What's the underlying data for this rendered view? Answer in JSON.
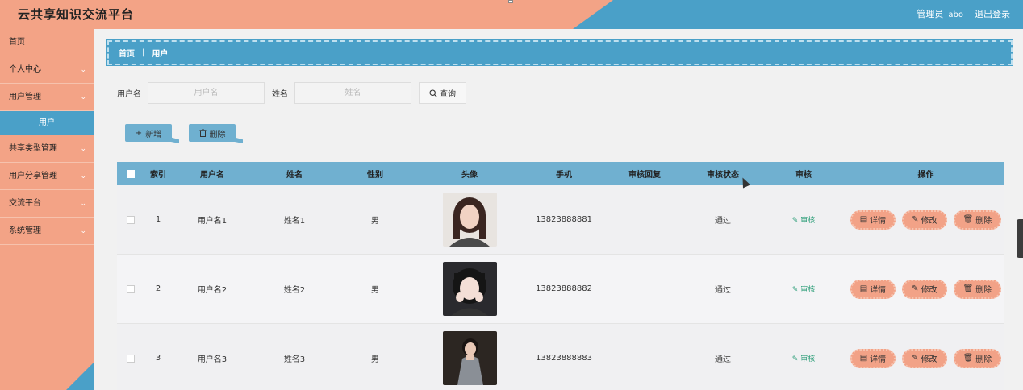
{
  "header": {
    "title": "云共享知识交流平台",
    "role": "管理员",
    "username": "abo",
    "logout": "退出登录"
  },
  "sidebar": {
    "items": [
      {
        "label": "首页",
        "has_sub": false
      },
      {
        "label": "个人中心",
        "has_sub": true
      },
      {
        "label": "用户管理",
        "has_sub": true
      },
      {
        "label": "用户",
        "is_sub": true,
        "active": true
      },
      {
        "label": "共享类型管理",
        "has_sub": true
      },
      {
        "label": "用户分享管理",
        "has_sub": true
      },
      {
        "label": "交流平台",
        "has_sub": true
      },
      {
        "label": "系统管理",
        "has_sub": true
      }
    ]
  },
  "breadcrumb": {
    "home": "首页",
    "current": "用户"
  },
  "search": {
    "username_label": "用户名",
    "username_placeholder": "用户名",
    "name_label": "姓名",
    "name_placeholder": "姓名",
    "query_label": "查询"
  },
  "actions": {
    "add": "新增",
    "delete": "删除"
  },
  "table": {
    "headers": [
      "索引",
      "用户名",
      "姓名",
      "性别",
      "头像",
      "手机",
      "审核回复",
      "审核状态",
      "审核",
      "操作"
    ],
    "rows": [
      {
        "index": "1",
        "username": "用户名1",
        "name": "姓名1",
        "gender": "男",
        "phone": "13823888881",
        "reply": "",
        "status": "通过",
        "audit": "审核"
      },
      {
        "index": "2",
        "username": "用户名2",
        "name": "姓名2",
        "gender": "男",
        "phone": "13823888882",
        "reply": "",
        "status": "通过",
        "audit": "审核"
      },
      {
        "index": "3",
        "username": "用户名3",
        "name": "姓名3",
        "gender": "男",
        "phone": "13823888883",
        "reply": "",
        "status": "通过",
        "audit": "审核"
      }
    ],
    "row_ops": {
      "detail": "详情",
      "edit": "修改",
      "delete": "删除"
    }
  },
  "colors": {
    "salmon": "#f3a386",
    "blue": "#4aa0c8",
    "header_row": "#70b0d0",
    "audit": "#2f9f7a"
  }
}
